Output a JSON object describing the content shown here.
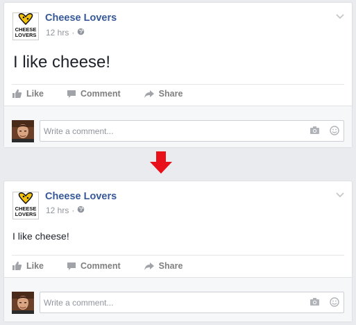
{
  "posts": [
    {
      "page_name": "Cheese Lovers",
      "logo_text": [
        "CHEESE",
        "LOVERS"
      ],
      "time": "12 hrs",
      "separator": "·",
      "text": "I like cheese!",
      "actions": {
        "like": "Like",
        "comment": "Comment",
        "share": "Share"
      },
      "comment_placeholder": "Write a comment..."
    },
    {
      "page_name": "Cheese Lovers",
      "logo_text": [
        "CHEESE",
        "LOVERS"
      ],
      "time": "12 hrs",
      "separator": "·",
      "text": "I like cheese!",
      "actions": {
        "like": "Like",
        "comment": "Comment",
        "share": "Share"
      },
      "comment_placeholder": "Write a comment..."
    }
  ],
  "colors": {
    "page_name": "#365899",
    "arrow": "#e8111a",
    "meta": "#90949c",
    "action": "#7f7f7f"
  },
  "icons": [
    "globe-icon",
    "chevron-down-icon",
    "like-icon",
    "comment-icon",
    "share-icon",
    "camera-icon",
    "emoji-icon",
    "down-arrow-icon"
  ]
}
